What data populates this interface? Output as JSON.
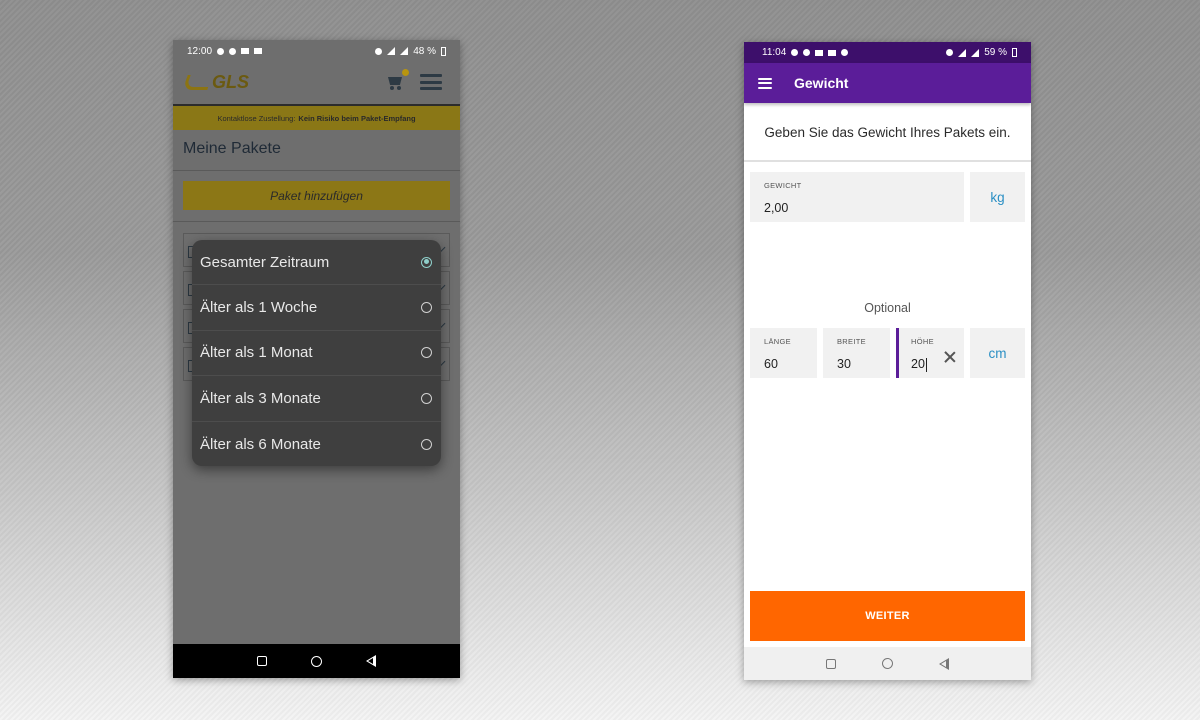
{
  "left_phone": {
    "status": {
      "time": "12:00",
      "battery": "48 %"
    },
    "header": {
      "logo_text": "GLS"
    },
    "banner": {
      "prefix": "Kontaktlose Zustellung:",
      "emphasis": "Kein Risiko beim Paket-Empfang"
    },
    "section_title": "Meine Pakete",
    "add_button_label": "Paket hinzufügen",
    "filter_popup": {
      "options": [
        {
          "label": "Gesamter Zeitraum",
          "selected": true
        },
        {
          "label": "Älter als 1 Woche",
          "selected": false
        },
        {
          "label": "Älter als 1 Monat",
          "selected": false
        },
        {
          "label": "Älter als 3 Monate",
          "selected": false
        },
        {
          "label": "Älter als 6 Monate",
          "selected": false
        }
      ]
    },
    "colors": {
      "gls_yellow": "#f5c400",
      "popup_bg": "#3f3f3f",
      "radio_checked": "#8fcfca"
    }
  },
  "right_phone": {
    "status": {
      "time": "11:04",
      "battery": "59 %"
    },
    "appbar": {
      "title": "Gewicht"
    },
    "instruction": "Geben Sie das Gewicht Ihres Pakets ein.",
    "weight": {
      "label": "GEWICHT",
      "value": "2,00",
      "unit": "kg"
    },
    "optional_label": "Optional",
    "dimensions": {
      "length": {
        "label": "LÄNGE",
        "value": "60"
      },
      "width": {
        "label": "BREITE",
        "value": "30"
      },
      "height": {
        "label": "HÖHE",
        "value": "20"
      },
      "unit": "cm"
    },
    "next_button_label": "WEITER",
    "colors": {
      "primary": "#5b1d99",
      "accent": "#ff6600",
      "unit_text": "#2a8fc4"
    }
  }
}
